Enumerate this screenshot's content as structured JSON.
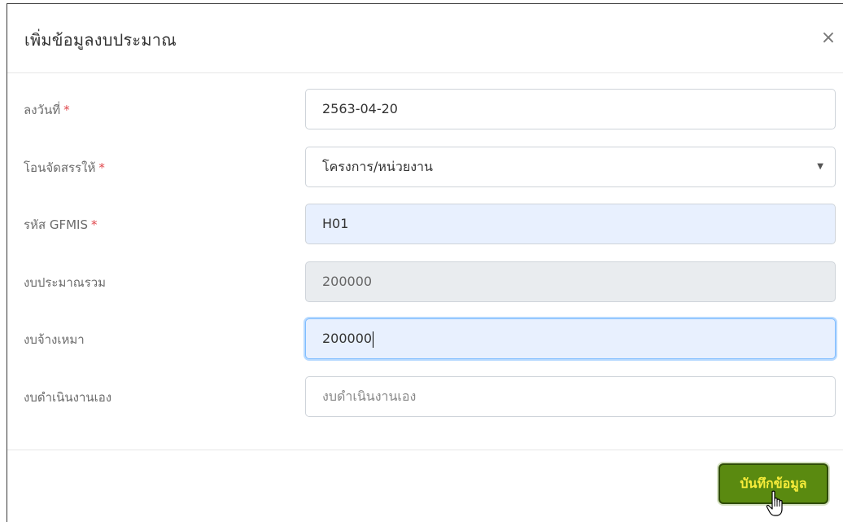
{
  "dialog": {
    "title": "เพิ่มข้อมูลงบประมาณ",
    "close_glyph": "×"
  },
  "fields": {
    "date": {
      "label": "ลงวันที่",
      "required_mark": "*",
      "value": "2563-04-20"
    },
    "transfer_to": {
      "label": "โอนจัดสรรให้",
      "required_mark": "*",
      "value": "โครงการ/หน่วยงาน"
    },
    "gfmis_code": {
      "label": "รหัส GFMIS",
      "required_mark": "*",
      "value": "H01"
    },
    "total_budget": {
      "label": "งบประมาณรวม",
      "value": "200000"
    },
    "contract_budget": {
      "label": "งบจ้างเหมา",
      "value": "200000"
    },
    "self_budget": {
      "label": "งบดำเนินงานเอง",
      "placeholder": "งบดำเนินงานเอง"
    }
  },
  "footer": {
    "save_label": "บันทึกข้อมูล"
  },
  "colors": {
    "required": "#e0474c",
    "save_button_bg": "#5a8a10",
    "save_button_text": "#f7ec3a",
    "autofill_bg": "#e8f0fe",
    "disabled_bg": "#e9ecef"
  },
  "icons": {
    "close": "close-icon",
    "select_arrow": "chevron-down-icon",
    "pointer": "hand-pointer-cursor-icon"
  }
}
